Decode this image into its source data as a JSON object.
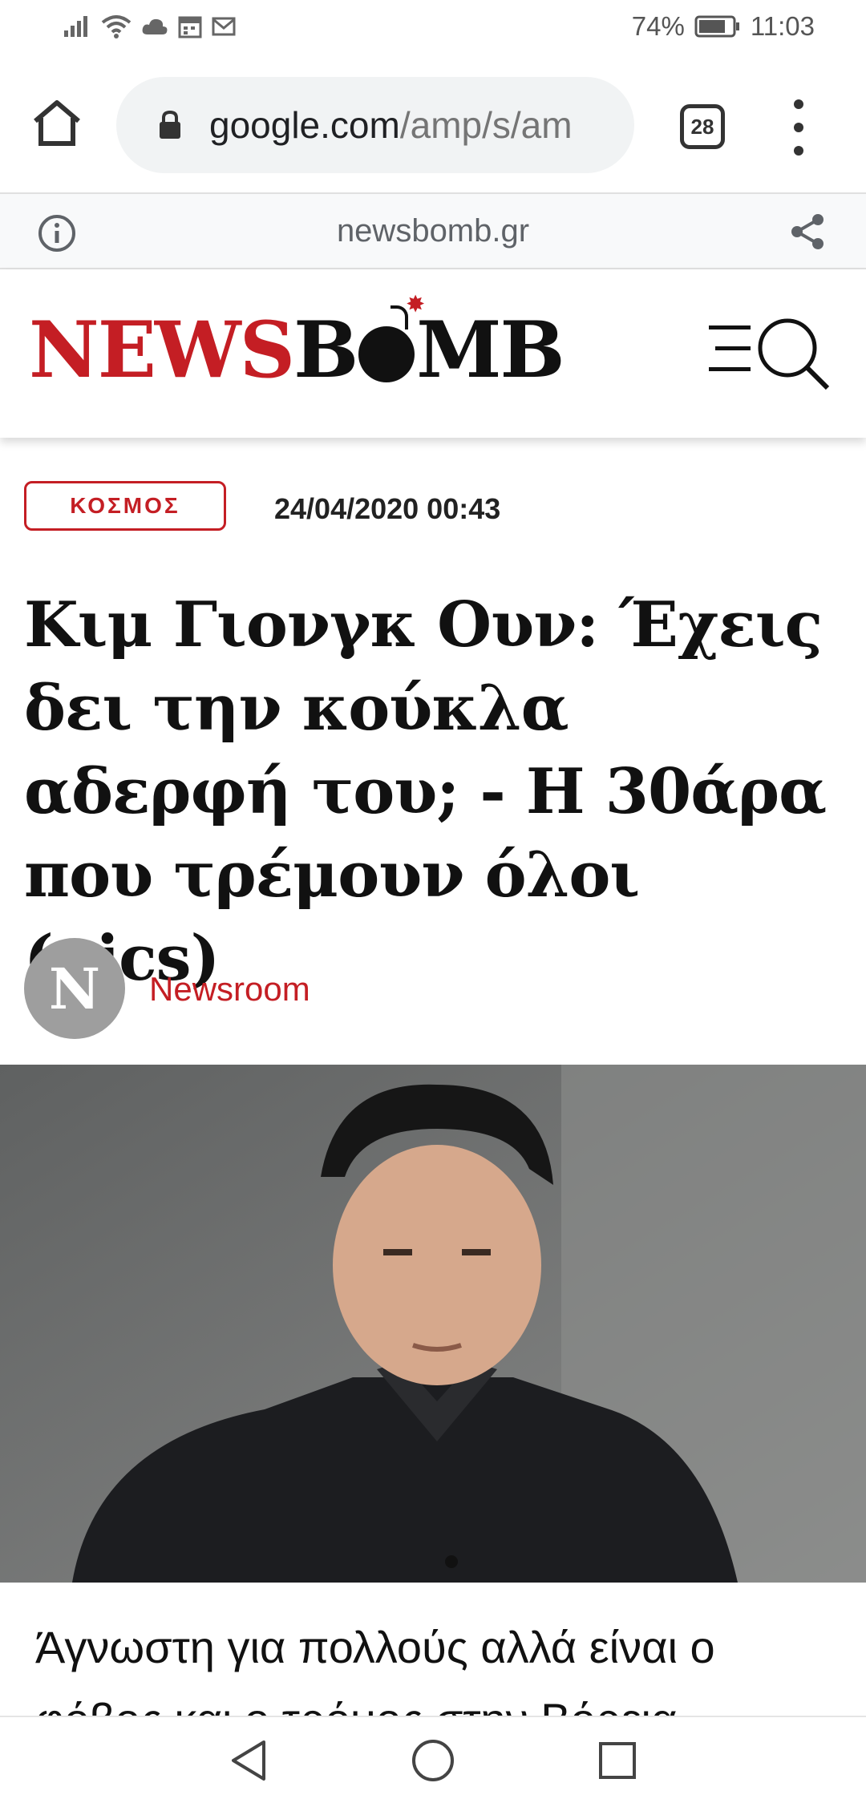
{
  "status_bar": {
    "battery": "74%",
    "time": "11:03",
    "icons": [
      "signal-icon",
      "wifi-icon",
      "cloud-icon",
      "calendar-icon",
      "gmail-icon",
      "battery-icon"
    ]
  },
  "browser": {
    "url_host": "google.com",
    "url_path": "/amp/s/am",
    "tab_count": "28",
    "amp_host": "newsbomb.gr"
  },
  "site": {
    "logo_part1": "NEWS",
    "logo_part2a": "B",
    "logo_part2b": "MB",
    "brand_color": "#c41e24"
  },
  "article": {
    "category": "ΚΟΣΜΟΣ",
    "date": "24/04/2020 00:43",
    "headline": "Κιμ Γιονγκ Ουν: Έχεις δει την κούκλα αδερφή του; - Η 30άρα που τρέμουν όλοι (pics)",
    "author_initial": "N",
    "author": "Newsroom",
    "lead": "Άγνωστη για πολλούς αλλά είναι ο φόβος και ο τρόμος στην Βόρεια"
  }
}
